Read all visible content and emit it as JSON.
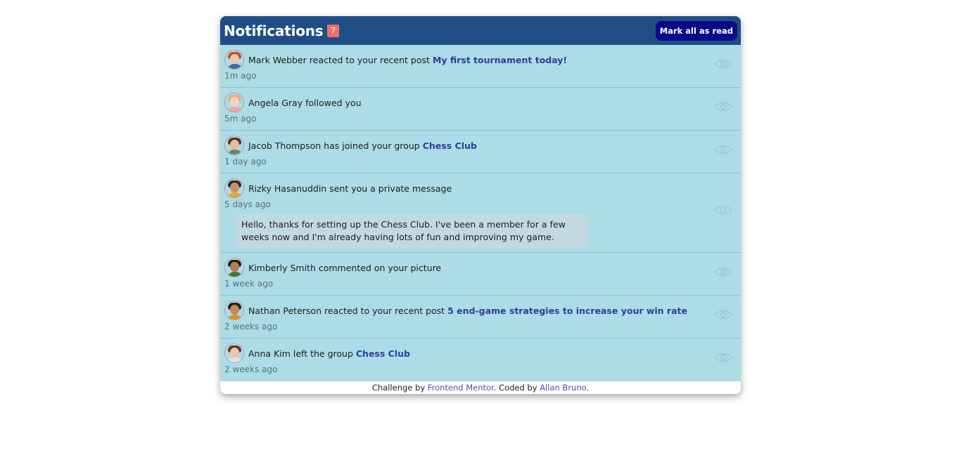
{
  "header": {
    "title": "Notifications",
    "unread_count": "7",
    "mark_all_label": "Mark all as read"
  },
  "notifications": [
    {
      "name": "Mark Webber",
      "action": "reacted to your recent post",
      "target": "My first tournament today!",
      "time": "1m ago",
      "icon": "eye-icon"
    },
    {
      "name": "Angela Gray",
      "action": "followed you",
      "target": "",
      "time": "5m ago",
      "icon": "eye-icon"
    },
    {
      "name": "Jacob Thompson",
      "action": "has joined your group",
      "target": "Chess Club",
      "time": "1 day ago",
      "icon": "eye-icon"
    },
    {
      "name": "Rizky Hasanuddin",
      "action": "sent you a private message",
      "target": "",
      "time": "5 days ago",
      "message": "Hello, thanks for setting up the Chess Club. I've been a member for a few weeks now and I'm already having lots of fun and improving my game.",
      "icon": "eye-icon"
    },
    {
      "name": "Kimberly Smith",
      "action": "commented on your picture",
      "target": "",
      "time": "1 week ago",
      "icon": "eye-icon"
    },
    {
      "name": "Nathan Peterson",
      "action": "reacted to your recent post",
      "target": "5 end-game strategies to increase your win rate",
      "time": "2 weeks ago",
      "icon": "eye-icon"
    },
    {
      "name": "Anna Kim",
      "action": "left the group",
      "target": "Chess Club",
      "time": "2 weeks ago",
      "icon": "eye-icon"
    }
  ],
  "footer": {
    "prefix": "Challenge by",
    "link1": "Frontend Mentor",
    "middle": ". Coded by",
    "link2": "Allan Bruno",
    "suffix": "."
  },
  "colors": {
    "header_bg": "#1f4e87",
    "list_bg": "#acdde6",
    "badge": "#f46b6b",
    "button_bg": "#0a0a8a",
    "link": "#2c3e9a"
  }
}
